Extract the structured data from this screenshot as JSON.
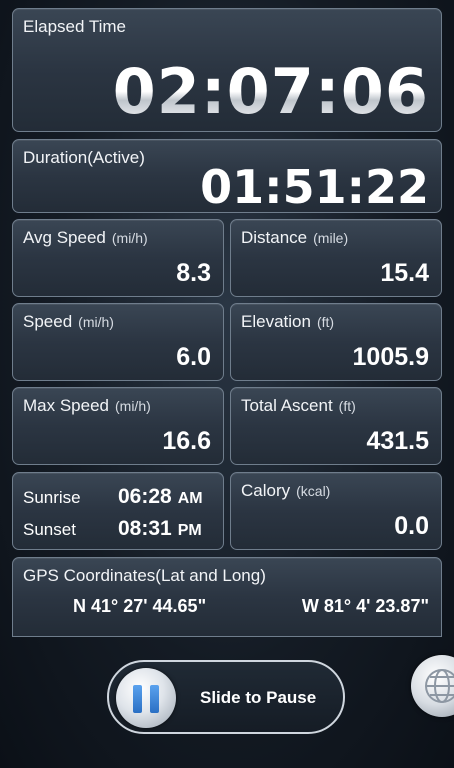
{
  "elapsed": {
    "label": "Elapsed Time",
    "value": "02:07:06"
  },
  "duration": {
    "label": "Duration(Active)",
    "value": "01:51:22"
  },
  "avg_speed": {
    "label": "Avg Speed",
    "unit": "(mi/h)",
    "value": "8.3"
  },
  "distance": {
    "label": "Distance",
    "unit": "(mile)",
    "value": "15.4"
  },
  "speed": {
    "label": "Speed",
    "unit": "(mi/h)",
    "value": "6.0"
  },
  "elevation": {
    "label": "Elevation",
    "unit": "(ft)",
    "value": "1005.9"
  },
  "max_speed": {
    "label": "Max Speed",
    "unit": "(mi/h)",
    "value": "16.6"
  },
  "total_ascent": {
    "label": "Total Ascent",
    "unit": "(ft)",
    "value": "431.5"
  },
  "sun": {
    "sunrise_label": "Sunrise",
    "sunrise_time": "06:28",
    "sunrise_ampm": "AM",
    "sunset_label": "Sunset",
    "sunset_time": "08:31",
    "sunset_ampm": "PM"
  },
  "calory": {
    "label": "Calory",
    "unit": "(kcal)",
    "value": "0.0"
  },
  "gps": {
    "label": "GPS Coordinates(Lat and Long)",
    "lat": "N 41° 27' 44.65\"",
    "long": "W 81° 4' 23.87\""
  },
  "controls": {
    "slide_label": "Slide to Pause",
    "pause_icon": "pause-icon",
    "globe_icon": "globe-icon"
  }
}
